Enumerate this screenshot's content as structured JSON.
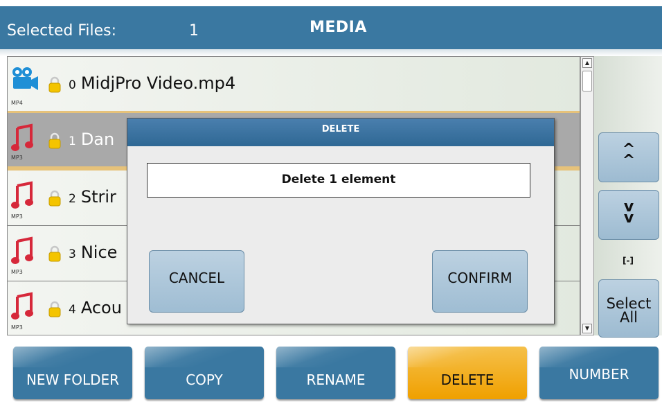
{
  "header": {
    "selected_label": "Selected Files:",
    "selected_count": "1",
    "title": "MEDIA"
  },
  "files": [
    {
      "index": "0",
      "name": "MidjPro Video.mp4",
      "type": "MP4",
      "icon": "video-camera-icon"
    },
    {
      "index": "1",
      "name": "Dan",
      "type": "MP3",
      "icon": "music-note-icon"
    },
    {
      "index": "2",
      "name": "Strir",
      "type": "MP3",
      "icon": "music-note-icon"
    },
    {
      "index": "3",
      "name": "Nice",
      "type": "MP3",
      "icon": "music-note-icon"
    },
    {
      "index": "4",
      "name": "Acou",
      "type": "MP3",
      "icon": "music-note-icon"
    }
  ],
  "side_panel": {
    "up_label": "^\n^",
    "down_label": "v\nv",
    "range_label": "[-]",
    "select_all_label": "Select All"
  },
  "toolbar": {
    "new_folder": "NEW FOLDER",
    "copy": "COPY",
    "rename": "RENAME",
    "delete": "DELETE",
    "number": "NUMBER"
  },
  "dialog": {
    "title": "DELETE",
    "message": "Delete 1 element",
    "cancel": "CANCEL",
    "confirm": "CONFIRM"
  },
  "colors": {
    "header": "#3a78a1",
    "active_button": "#f0a000",
    "button_light": "#a9c5da",
    "selected_row": "#a9a9a9"
  },
  "scroll": {
    "position": "top"
  }
}
